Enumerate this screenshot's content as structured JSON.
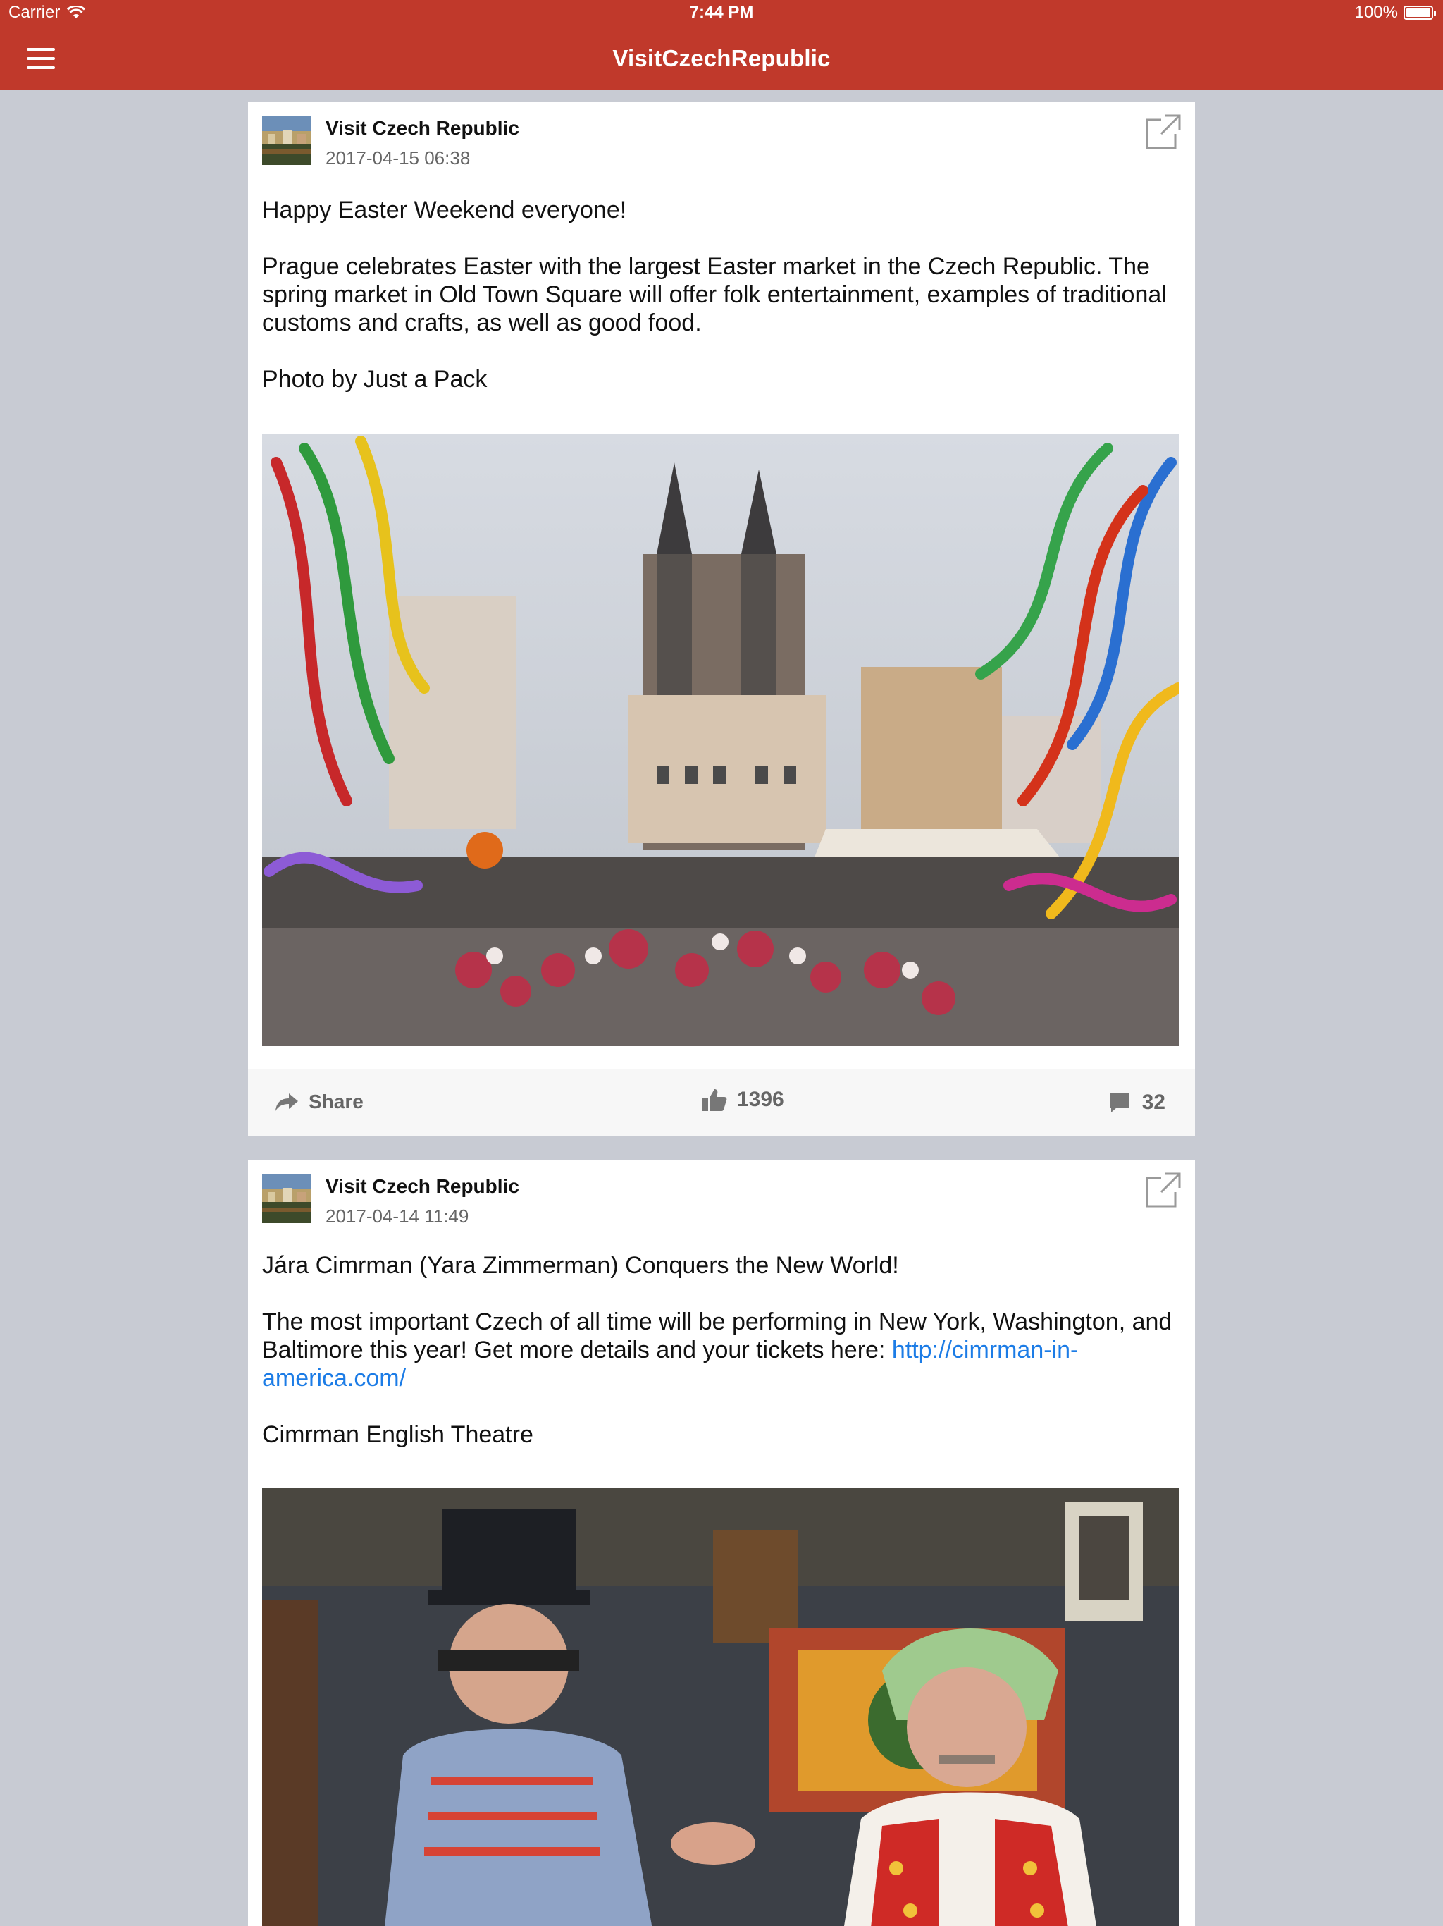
{
  "status_bar": {
    "carrier": "Carrier",
    "time": "7:44 PM",
    "battery": "100%"
  },
  "nav": {
    "title": "VisitCzechRepublic"
  },
  "colors": {
    "brand_red": "#c0392b",
    "link_blue": "#1c7ce6",
    "background": "#c8cbd3"
  },
  "posts": [
    {
      "author": "Visit Czech Republic",
      "date": "2017-04-15 06:38",
      "paragraphs": [
        "Happy Easter Weekend everyone!",
        "Prague celebrates Easter with the largest Easter market in the Czech Republic. The spring market in Old Town Square will offer folk entertainment, examples of traditional customs and crafts, as well as good food.",
        "Photo by Just a Pack"
      ],
      "share_label": "Share",
      "likes": "1396",
      "comments": "32"
    },
    {
      "author": "Visit Czech Republic",
      "date": "2017-04-14 11:49",
      "paragraphs": [
        "Jára Cimrman (Yara Zimmerman) Conquers the New World!",
        "The most important Czech of all time will be performing in New York, Washington, and Baltimore this year! Get more details and your tickets here:",
        "Cimrman English Theatre"
      ],
      "link": "http://cimrman-in-america.com/"
    }
  ]
}
